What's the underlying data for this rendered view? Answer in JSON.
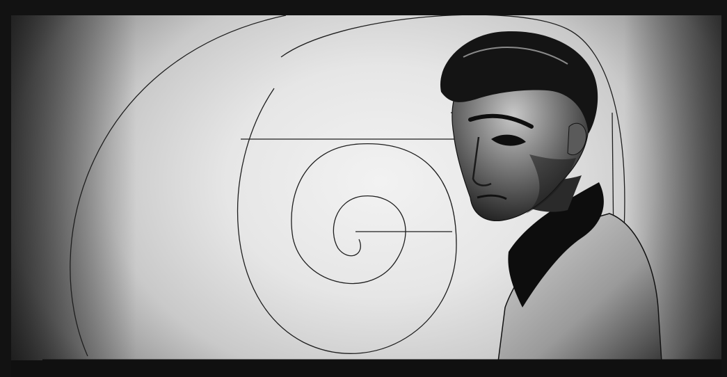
{
  "artwork": {
    "subject": "portrait-man",
    "overlay": "golden-spiral",
    "palette": {
      "frame": "#121212",
      "background_light": "#efefef",
      "background_dark": "#3e3e3e",
      "ink": "#111111",
      "line": "#222222"
    }
  }
}
